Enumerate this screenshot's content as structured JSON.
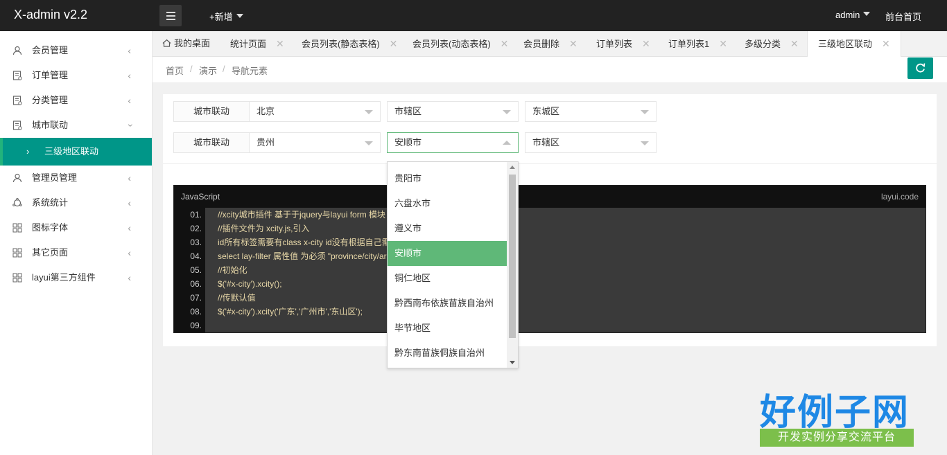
{
  "app": {
    "title": "X-admin v2.2"
  },
  "header": {
    "add_new": "+新增",
    "user": "admin",
    "frontend_link": "前台首页"
  },
  "sidebar": {
    "items": [
      {
        "label": "会员管理",
        "icon": "user-icon"
      },
      {
        "label": "订单管理",
        "icon": "order-icon"
      },
      {
        "label": "分类管理",
        "icon": "category-icon"
      },
      {
        "label": "城市联动",
        "icon": "city-icon"
      },
      {
        "label": "管理员管理",
        "icon": "admin-icon"
      },
      {
        "label": "系统统计",
        "icon": "stats-icon"
      },
      {
        "label": "图标字体",
        "icon": "grid-icon"
      },
      {
        "label": "其它页面",
        "icon": "grid-icon"
      },
      {
        "label": "layui第三方组件",
        "icon": "grid-icon"
      }
    ],
    "sub_active": "三级地区联动"
  },
  "tabs": [
    {
      "label": "我的桌面"
    },
    {
      "label": "统计页面"
    },
    {
      "label": "会员列表(静态表格)"
    },
    {
      "label": "会员列表(动态表格)"
    },
    {
      "label": "会员删除"
    },
    {
      "label": "订单列表"
    },
    {
      "label": "订单列表1"
    },
    {
      "label": "多级分类"
    },
    {
      "label": "三级地区联动"
    }
  ],
  "breadcrumb": [
    "首页",
    "演示",
    "导航元素"
  ],
  "form": {
    "rows": [
      {
        "label": "城市联动",
        "province": "北京",
        "city": "市辖区",
        "district": "东城区"
      },
      {
        "label": "城市联动",
        "province": "贵州",
        "city": "安顺市",
        "district": "市辖区"
      }
    ]
  },
  "dropdown": {
    "options": [
      "贵阳市",
      "六盘水市",
      "遵义市",
      "安顺市",
      "铜仁地区",
      "黔西南布依族苗族自治州",
      "毕节地区",
      "黔东南苗族侗族自治州"
    ],
    "selected": "安顺市"
  },
  "code": {
    "lang": "JavaScript",
    "brand": "layui.code",
    "lines": [
      {
        "no": "01.",
        "text": "//xcity城市插件 基于于jquery与layui form 模块"
      },
      {
        "no": "02.",
        "text": "//插件文件为 xcity.js,引入"
      },
      {
        "no": "03.",
        "text": "id所有标签需要有class x-city  id没有根据自己需"
      },
      {
        "no": "04.",
        "text": "select lay-filter 属性值 为必须 \"province/city/ar"
      },
      {
        "no": "05.",
        "text": "//初始化"
      },
      {
        "no": "06.",
        "text": "$('#x-city').xcity();"
      },
      {
        "no": "07.",
        "text": "//传默认值"
      },
      {
        "no": "08.",
        "text": "$('#x-city').xcity('广东','广州市','东山区');"
      },
      {
        "no": "09.",
        "text": ""
      }
    ]
  },
  "watermark": {
    "title": "好例子网",
    "subtitle": "开发实例分享交流平台"
  },
  "colors": {
    "accent": "#009688",
    "selected": "#5FB878",
    "topbar": "#222222",
    "watermark_blue": "#1e88e5",
    "watermark_green": "#7cbf4b"
  }
}
